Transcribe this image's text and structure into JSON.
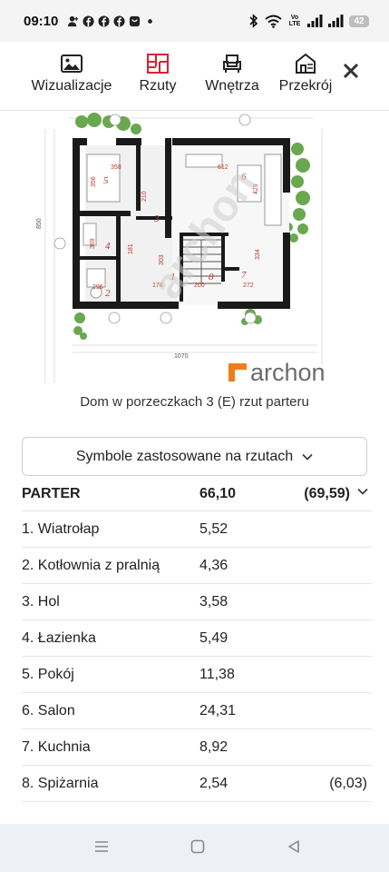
{
  "status_bar": {
    "time": "09:10",
    "network_label": "Vo LTE",
    "battery": "42",
    "icons": [
      "contact-icon",
      "facebook-icon",
      "facebook-icon",
      "facebook-icon",
      "instagram-icon",
      "dot-icon",
      "bluetooth-icon",
      "wifi-icon",
      "signal-icon",
      "signal-icon",
      "battery-icon"
    ]
  },
  "tabs": [
    {
      "label": "Wizualizacje",
      "icon": "image-icon"
    },
    {
      "label": "Rzuty",
      "icon": "floorplan-icon",
      "active": true,
      "color": "#d22630"
    },
    {
      "label": "Wnętrza",
      "icon": "armchair-icon"
    },
    {
      "label": "Przekrój",
      "icon": "house-section-icon"
    }
  ],
  "close_icon": "close-icon",
  "plan": {
    "brand": "archon",
    "brand_color": "#f07d1a",
    "rooms": [
      "1",
      "2",
      "3",
      "4",
      "5",
      "6",
      "7",
      "8"
    ],
    "dims": [
      "358",
      "612",
      "1070",
      "850",
      "356",
      "429",
      "334",
      "200",
      "272",
      "296",
      "178"
    ]
  },
  "caption": "Dom w porzeczkach 3 (E) rzut parteru",
  "symbols_button": "Symbole zastosowane na rzutach",
  "table": {
    "header": {
      "name": "PARTER",
      "area": "66,10",
      "total": "(69,59)"
    },
    "rows": [
      {
        "name": "1. Wiatrołap",
        "area": "5,52",
        "extra": ""
      },
      {
        "name": "2. Kotłownia z pralnią",
        "area": "4,36",
        "extra": ""
      },
      {
        "name": "3. Hol",
        "area": "3,58",
        "extra": ""
      },
      {
        "name": "4. Łazienka",
        "area": "5,49",
        "extra": ""
      },
      {
        "name": "5. Pokój",
        "area": "11,38",
        "extra": ""
      },
      {
        "name": "6. Salon",
        "area": "24,31",
        "extra": ""
      },
      {
        "name": "7. Kuchnia",
        "area": "8,92",
        "extra": ""
      },
      {
        "name": "8. Spiżarnia",
        "area": "2,54",
        "extra": "(6,03)"
      }
    ]
  },
  "nav": [
    "menu-icon",
    "home-icon",
    "back-icon"
  ]
}
